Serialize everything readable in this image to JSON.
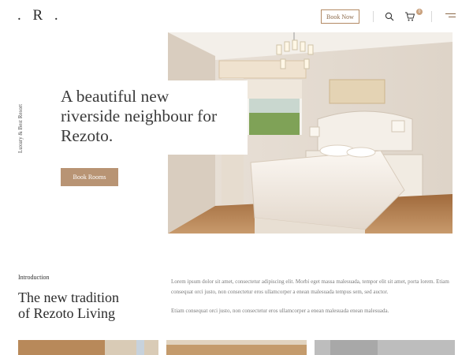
{
  "header": {
    "logo": ". R .",
    "book_now_label": "Book Now",
    "cart_count": "0"
  },
  "side_text": "Luxury & Best Resort",
  "hero": {
    "title_line1": "A beautiful new",
    "title_line2": "riverside neighbour for",
    "title_line3": "Rezoto.",
    "button_label": "Book Rooms"
  },
  "intro": {
    "label": "Introduction",
    "title_line1": "The new tradition",
    "title_line2": "of Rezoto Living",
    "paragraph1": "Lorem ipsum dolor sit amet, consectetur adipiscing elit. Morbi eget massa malesuada, tempor elit sit amet, porta lorem. Etiam consequat orci justo, non consectetur eros ullamcorper a enean malesuada tempus sem, sed auctor.",
    "paragraph2": "Etiam consequat orci justo, non consectetur eros ullamcorper a enean malesuada enean malesuada."
  },
  "colors": {
    "accent": "#b89474",
    "text_dark": "#3b3b3b",
    "text_muted": "#7a7a7a"
  }
}
